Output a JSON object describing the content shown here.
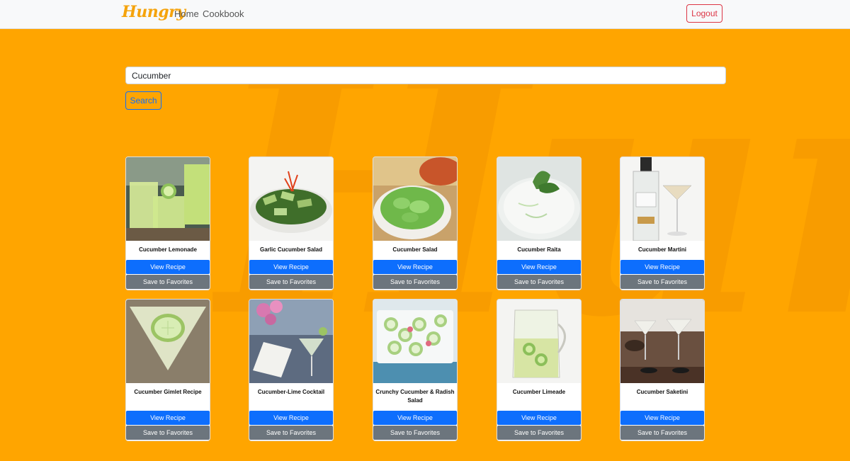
{
  "navbar": {
    "brand": "Hungry",
    "links": [
      "Home",
      "Cookbook"
    ],
    "logout_label": "Logout"
  },
  "search": {
    "value": "Cucumber",
    "button_label": "Search"
  },
  "card_actions": {
    "view_label": "View Recipe",
    "save_label": "Save to Favorites"
  },
  "recipes": [
    {
      "title": "Cucumber Lemonade"
    },
    {
      "title": "Garlic Cucumber Salad"
    },
    {
      "title": "Cucumber Salad"
    },
    {
      "title": "Cucumber Raita"
    },
    {
      "title": "Cucumber Martini"
    },
    {
      "title": "Cucumber Gimlet Recipe"
    },
    {
      "title": "Cucumber-Lime Cocktail"
    },
    {
      "title": "Crunchy Cucumber & Radish Salad"
    },
    {
      "title": "Cucumber Limeade"
    },
    {
      "title": "Cucumber Saketini"
    }
  ],
  "colors": {
    "background": "#ffa500",
    "primary": "#0d6efd",
    "secondary": "#6c757d",
    "danger": "#dc3545",
    "brand": "#f5a30c"
  }
}
